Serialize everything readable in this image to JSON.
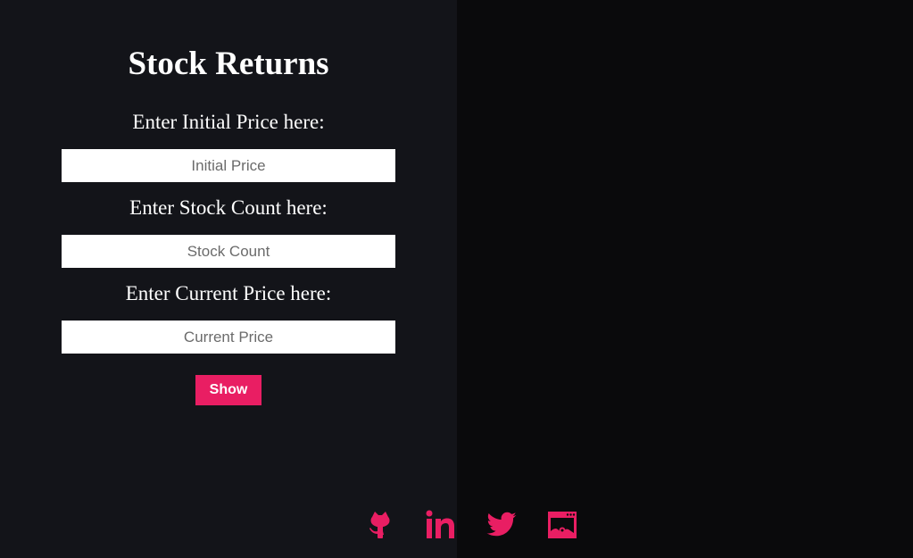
{
  "app": {
    "title": "Stock Returns"
  },
  "form": {
    "initial_price": {
      "label": "Enter Initial Price here:",
      "placeholder": "Initial Price",
      "value": ""
    },
    "stock_count": {
      "label": "Enter Stock Count here:",
      "placeholder": "Stock Count",
      "value": ""
    },
    "current_price": {
      "label": "Enter Current Price here:",
      "placeholder": "Current Price",
      "value": ""
    },
    "show_label": "Show"
  },
  "footer": {
    "icons": [
      "github-icon",
      "linkedin-icon",
      "twitter-icon",
      "portfolio-icon"
    ]
  },
  "colors": {
    "accent": "#e91e63",
    "left_panel_bg": "#131419",
    "right_panel_bg": "#0a0a0c",
    "text": "#ffffff"
  }
}
